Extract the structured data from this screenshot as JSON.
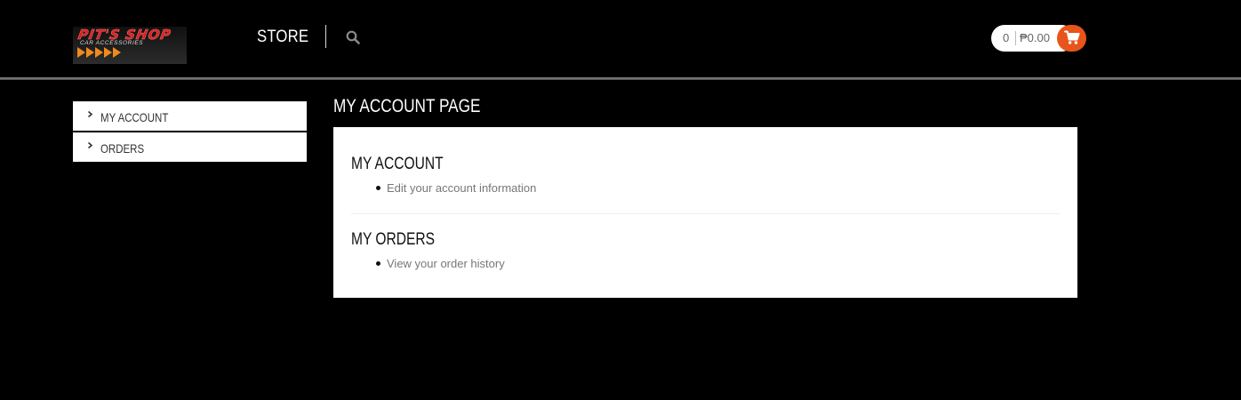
{
  "header": {
    "logo": {
      "title": "PIT'S SHOP",
      "subtitle": "CAR ACCESSORIES"
    },
    "nav": {
      "store_label": "STORE"
    },
    "cart": {
      "count": "0",
      "total": "₱0.00",
      "accent_color": "#e8541c"
    }
  },
  "sidebar": {
    "items": [
      {
        "label": "MY ACCOUNT"
      },
      {
        "label": "ORDERS"
      }
    ]
  },
  "main": {
    "page_title": "MY ACCOUNT PAGE",
    "sections": [
      {
        "title": "MY ACCOUNT",
        "link": "Edit your account information"
      },
      {
        "title": "MY ORDERS",
        "link": "View your order history"
      }
    ]
  },
  "icons": {
    "search": "search-icon",
    "cart": "shopping-cart-icon",
    "chevron": "chevron-right-icon"
  }
}
